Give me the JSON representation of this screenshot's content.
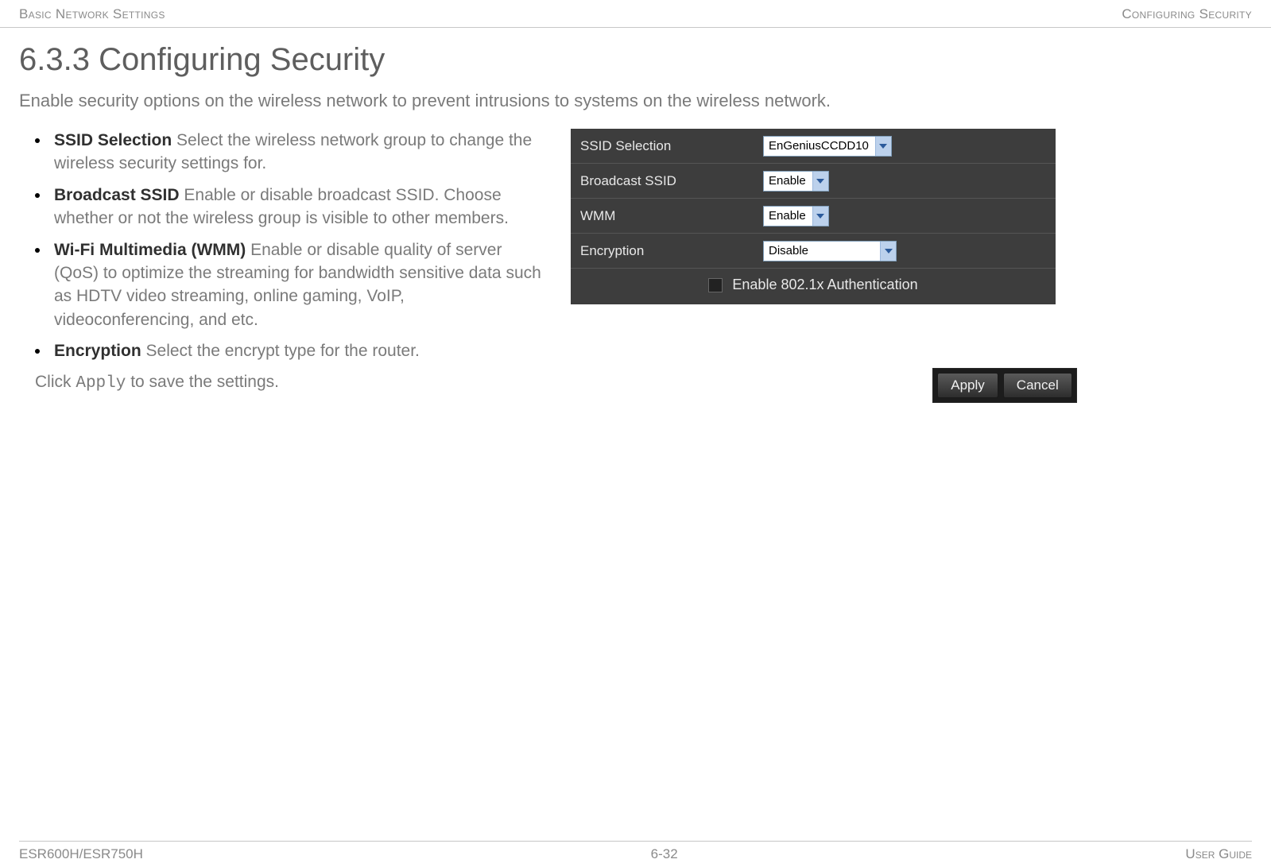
{
  "header": {
    "left": "Basic Network Settings",
    "right": "Configuring Security"
  },
  "section": {
    "title": "6.3.3 Configuring Security",
    "lead": "Enable security options on the wireless network to prevent intrusions to systems on the wireless network."
  },
  "bullets": [
    {
      "term": "SSID Selection",
      "desc": "  Select the wireless network group to change the wireless security settings for."
    },
    {
      "term": "Broadcast SSID",
      "desc": "  Enable or disable broadcast SSID. Choose whether or not the wireless group is visible to other members."
    },
    {
      "term": "Wi-Fi Multimedia (WMM)",
      "desc": "  Enable or disable quality of server (QoS) to optimize the streaming for bandwidth sensitive data such as HDTV video streaming, online gaming, VoIP, videoconferencing, and etc."
    },
    {
      "term": "Encryption",
      "desc": "  Select the encrypt type for the router."
    }
  ],
  "apply_note": {
    "pre": "Click ",
    "code": "Apply",
    "post": " to save the settings."
  },
  "panel": {
    "rows": {
      "ssid": {
        "label": "SSID Selection",
        "value": "EnGeniusCCDD10"
      },
      "broadcast": {
        "label": "Broadcast SSID",
        "value": "Enable"
      },
      "wmm": {
        "label": "WMM",
        "value": "Enable"
      },
      "encryption": {
        "label": "Encryption",
        "value": "Disable"
      }
    },
    "auth_label": "Enable 802.1x Authentication"
  },
  "buttons": {
    "apply": "Apply",
    "cancel": "Cancel"
  },
  "footer": {
    "left": "ESR600H/ESR750H",
    "center": "6-32",
    "right": "User Guide"
  }
}
